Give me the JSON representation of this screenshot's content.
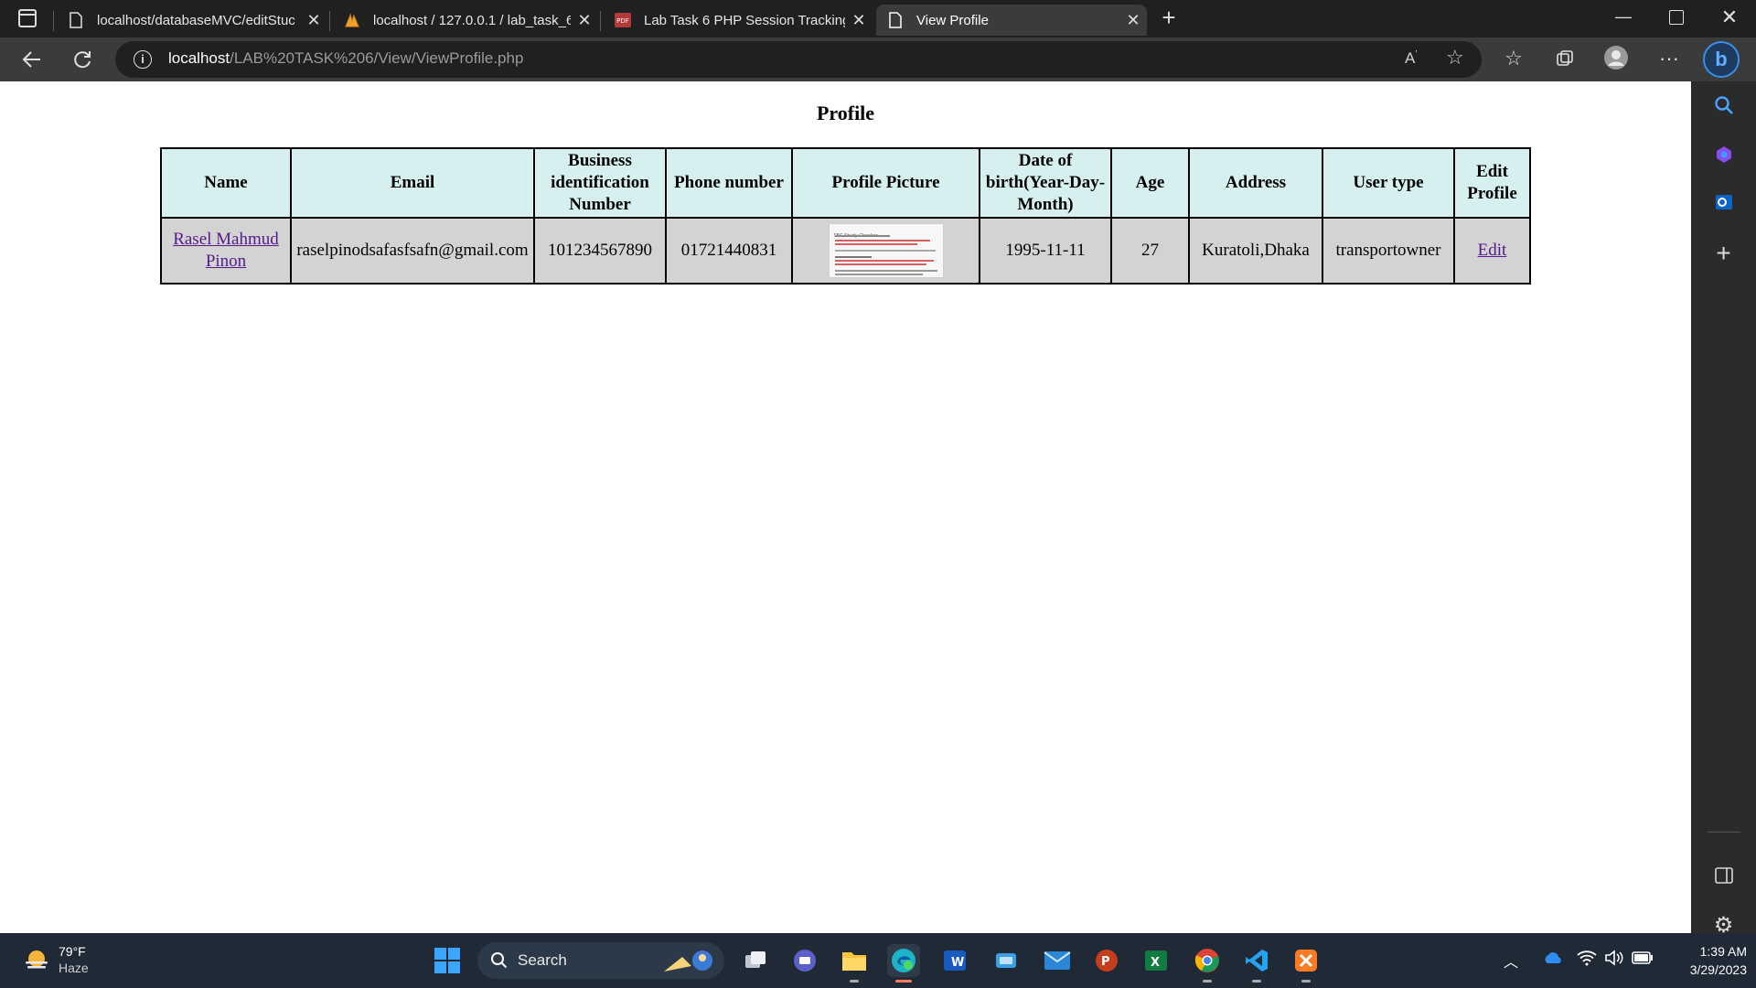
{
  "browser": {
    "tabs": [
      {
        "label": "localhost/databaseMVC/editStuc",
        "icon": "page-icon",
        "active": false
      },
      {
        "label": "localhost / 127.0.0.1 / lab_task_6",
        "icon": "phpmyadmin-icon",
        "active": false
      },
      {
        "label": "Lab Task 6 PHP Session Tracking",
        "icon": "pdf-icon",
        "active": false
      },
      {
        "label": "View Profile",
        "icon": "page-icon",
        "active": true
      }
    ],
    "address": {
      "host": "localhost",
      "path": "/LAB%20TASK%206/View/ViewProfile.php"
    }
  },
  "page": {
    "title": "Profile",
    "table": {
      "headers": {
        "name": "Name",
        "email": "Email",
        "bin": "Business identification Number",
        "phone": "Phone number",
        "picture": "Profile Picture",
        "dob": "Date of birth(Year-Day-Month)",
        "age": "Age",
        "address": "Address",
        "usertype": "User type",
        "edit": "Edit Profile"
      },
      "row": {
        "name": "Rasel Mahmud Pinon",
        "email": "raselpinodsafasfsafn@gmail.com",
        "bin": "101234567890",
        "phone": "01721440831",
        "dob": "1995-11-11",
        "age": "27",
        "address": "Kuratoli,Dhaka",
        "usertype": "transportowner",
        "edit": "Edit"
      },
      "thumbnail_caption": "SEG Study Checker"
    }
  },
  "taskbar": {
    "weather": {
      "temp": "79°F",
      "condition": "Haze"
    },
    "search_label": "Search",
    "clock": {
      "time": "1:39 AM",
      "date": "3/29/2023"
    }
  }
}
